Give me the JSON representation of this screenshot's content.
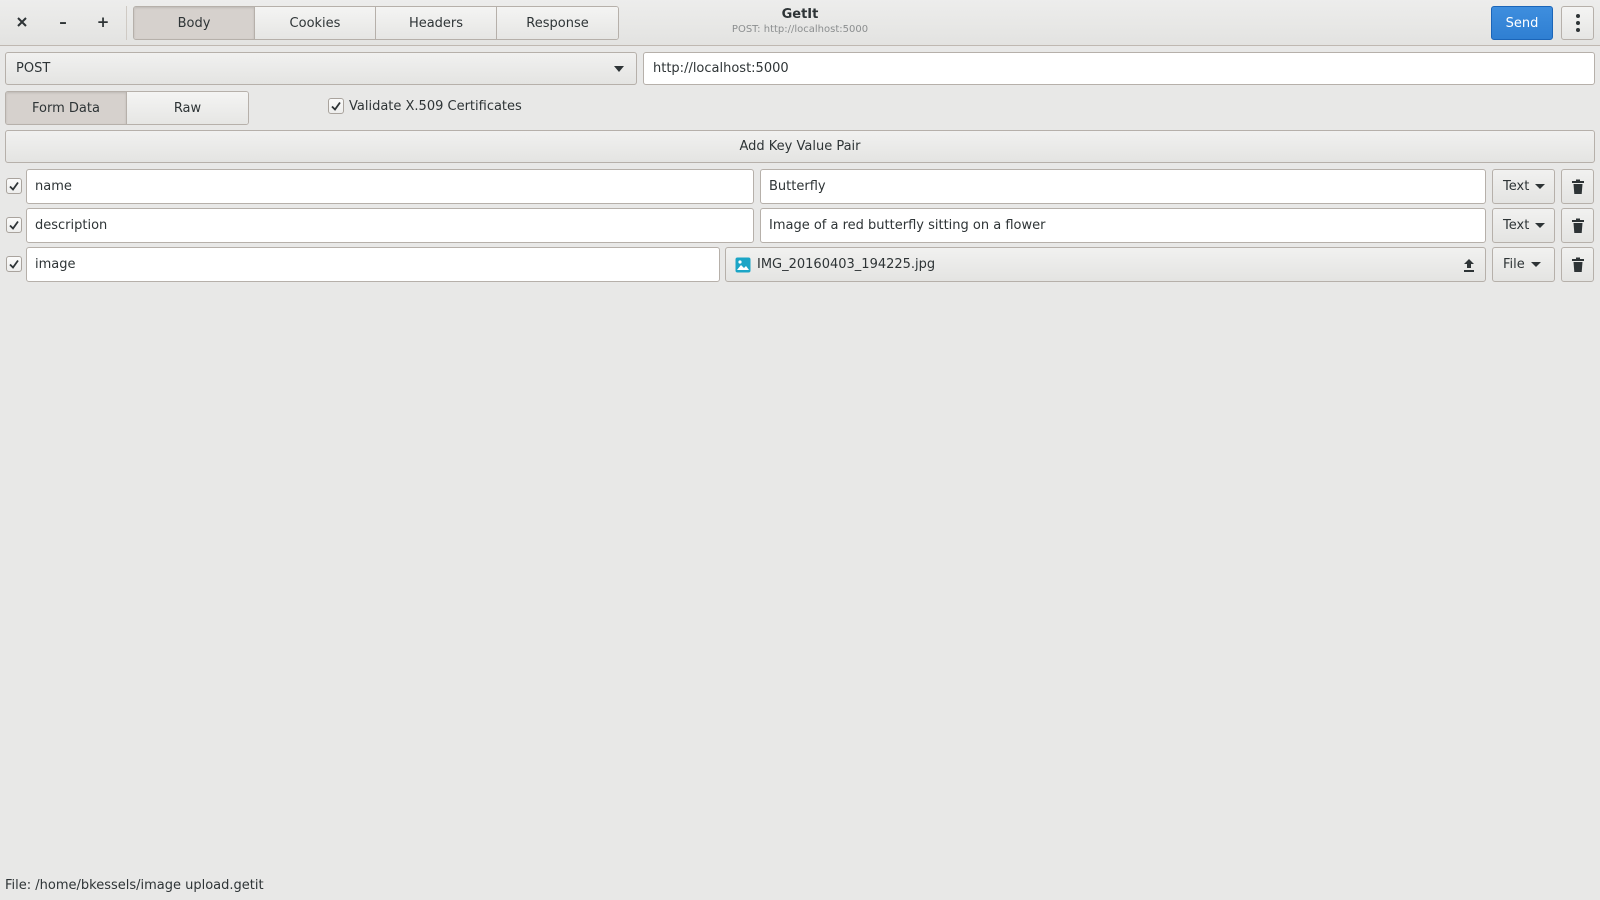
{
  "window": {
    "close_icon": "close-icon",
    "minimize_label": "–",
    "maximize_label": "+"
  },
  "header": {
    "tabs": [
      {
        "label": "Body",
        "active": true
      },
      {
        "label": "Cookies",
        "active": false
      },
      {
        "label": "Headers",
        "active": false
      },
      {
        "label": "Response",
        "active": false
      }
    ],
    "title": "GetIt",
    "subtitle": "POST: http://localhost:5000",
    "send_label": "Send",
    "accent_color": "#3584e4"
  },
  "request": {
    "method": "POST",
    "url": "http://localhost:5000"
  },
  "body_mode": {
    "options": [
      "Form Data",
      "Raw"
    ],
    "selected": "Form Data",
    "validate_label": "Validate X.509 Certificates",
    "validate_checked": true
  },
  "add_pair_label": "Add Key Value Pair",
  "pairs": [
    {
      "enabled": true,
      "key": "name",
      "value": "Butterfly",
      "type": "Text"
    },
    {
      "enabled": true,
      "key": "description",
      "value": "Image of a red butterfly sitting on a flower",
      "type": "Text"
    },
    {
      "enabled": true,
      "key": "image",
      "value": "IMG_20160403_194225.jpg",
      "type": "File"
    }
  ],
  "status_text": "File: /home/bkessels/image upload.getit"
}
